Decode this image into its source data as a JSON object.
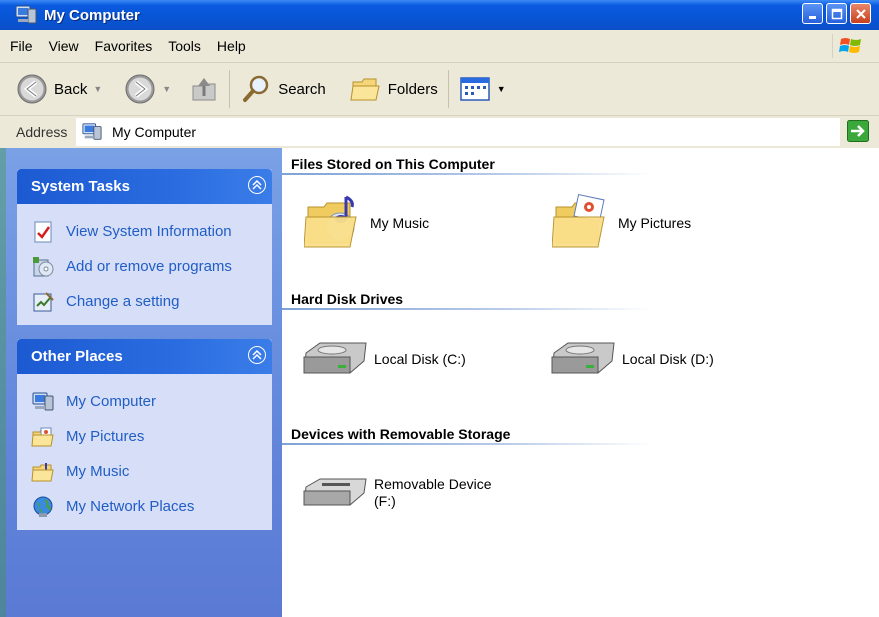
{
  "window": {
    "title": "My Computer"
  },
  "menu": [
    "File",
    "View",
    "Favorites",
    "Tools",
    "Help"
  ],
  "toolbar": {
    "back": "Back",
    "search": "Search",
    "folders": "Folders"
  },
  "address": {
    "label": "Address",
    "value": "My Computer"
  },
  "system_tasks": {
    "title": "System Tasks",
    "items": [
      "View System Information",
      "Add or remove programs",
      "Change a setting"
    ]
  },
  "other_places": {
    "title": "Other Places",
    "items": [
      "My Computer",
      "My Pictures",
      "My Music",
      "My Network Places"
    ]
  },
  "groups": {
    "files": {
      "title": "Files Stored on This Computer",
      "items": [
        "My Music",
        "My Pictures"
      ]
    },
    "hdd": {
      "title": "Hard Disk Drives",
      "items": [
        "Local Disk (C:)",
        "Local Disk (D:)"
      ]
    },
    "removable": {
      "title": "Devices with Removable Storage",
      "item_line1": "Removable Device",
      "item_line2": "(F:)"
    }
  },
  "colors": {
    "titlebar": "#0a5ae0",
    "task_link": "#215dc6",
    "left_pane": "#6488dc"
  }
}
